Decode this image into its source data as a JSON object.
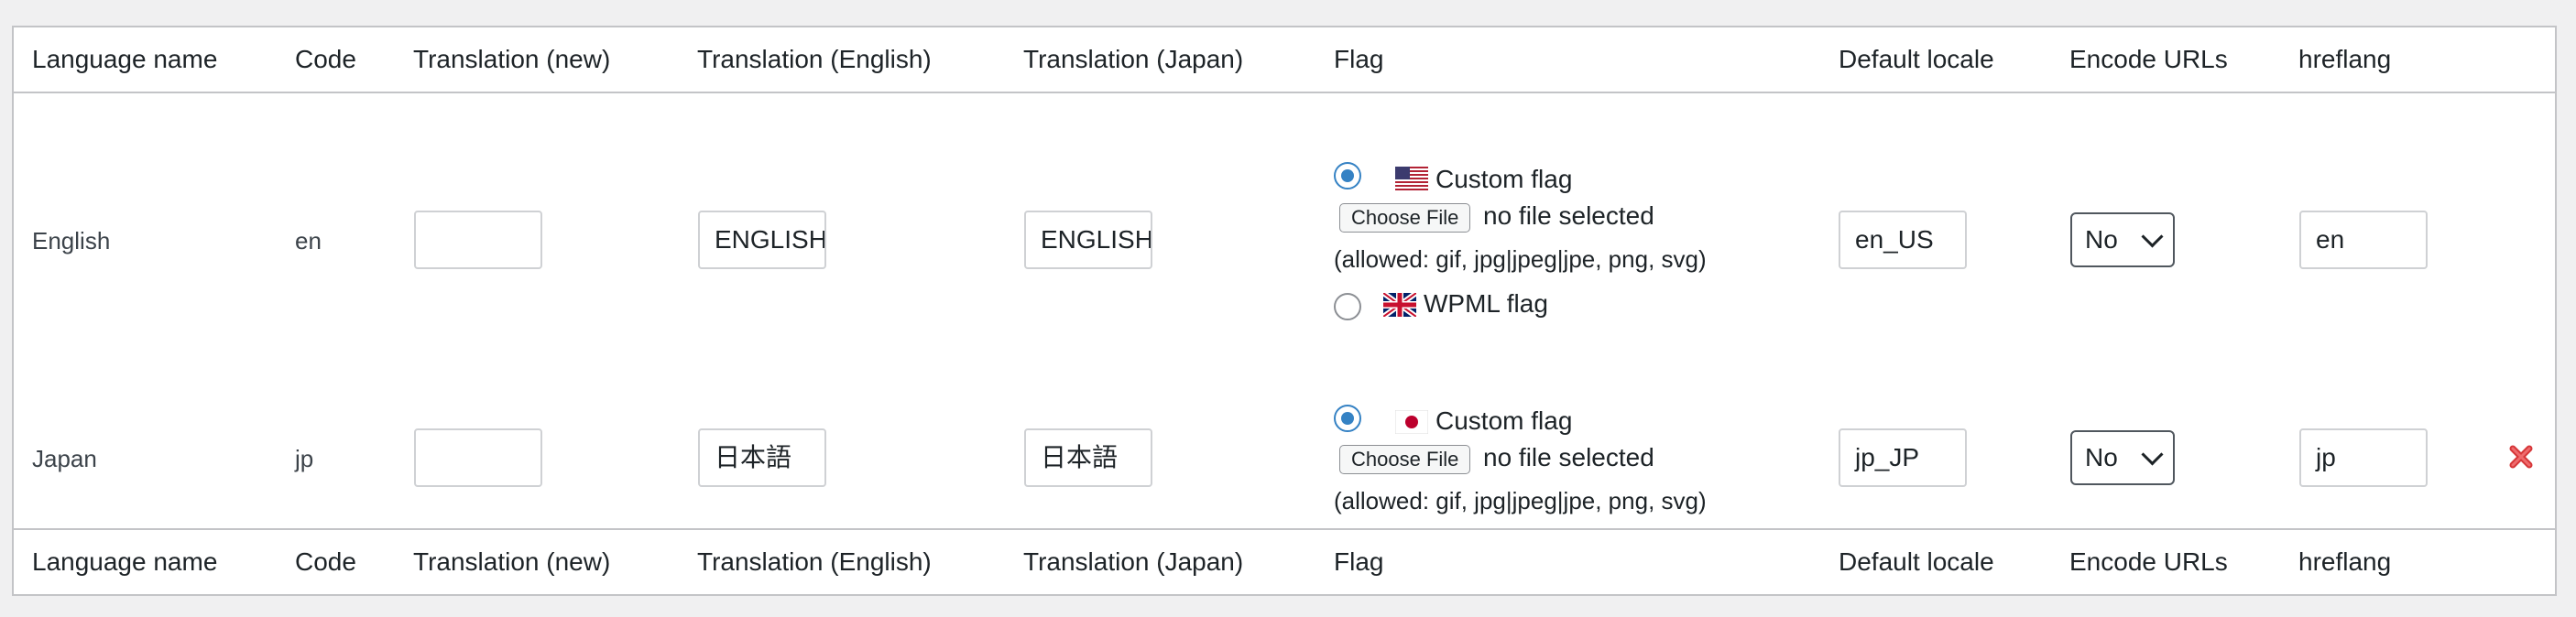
{
  "headers": {
    "language_name": "Language name",
    "code": "Code",
    "translation_new": "Translation (new)",
    "translation_english": "Translation (English)",
    "translation_japan": "Translation (Japan)",
    "flag": "Flag",
    "default_locale": "Default locale",
    "encode_urls": "Encode URLs",
    "hreflang": "hreflang"
  },
  "rows": [
    {
      "language_name": "English",
      "code": "en",
      "translation_new": "",
      "translation_english": "ENGLISH",
      "translation_japan": "ENGLISH",
      "custom_flag_label": "Custom flag",
      "custom_flag_selected": true,
      "choose_file": "Choose File",
      "no_file": "no file selected",
      "allowed": "(allowed: gif, jpg|jpeg|jpe, png, svg)",
      "wpml_flag_label": "WPML flag",
      "default_locale": "en_US",
      "encode_urls": "No",
      "hreflang": "en",
      "flag_icon": "us-flag-icon",
      "wpml_flag_icon": "uk-flag-icon"
    },
    {
      "language_name": "Japan",
      "code": "jp",
      "translation_new": "",
      "translation_english": "日本語",
      "translation_japan": "日本語",
      "custom_flag_label": "Custom flag",
      "custom_flag_selected": true,
      "choose_file": "Choose File",
      "no_file": "no file selected",
      "allowed": "(allowed: gif, jpg|jpeg|jpe, png, svg)",
      "default_locale": "jp_JP",
      "encode_urls": "No",
      "hreflang": "jp",
      "flag_icon": "japan-flag-icon",
      "delete_icon": "delete-icon"
    }
  ],
  "colors": {
    "radio_accent": "#3582c4",
    "delete_red": "#d63638",
    "border": "#c3c4c7"
  }
}
